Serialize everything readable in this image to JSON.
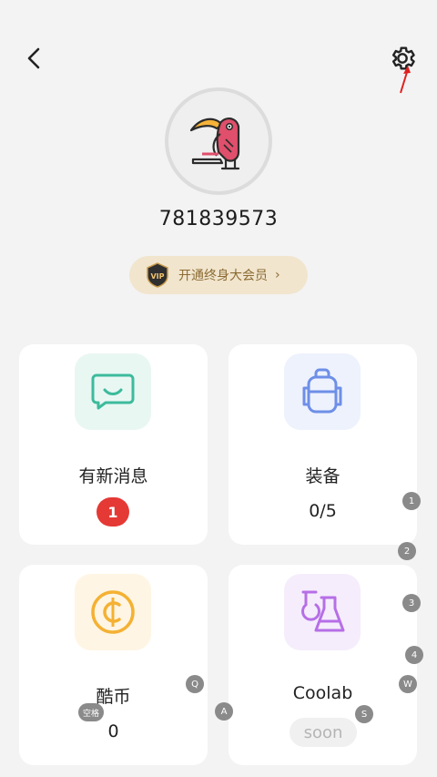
{
  "header": {
    "back_icon": "chevron-left-icon",
    "settings_icon": "gear-icon"
  },
  "profile": {
    "user_id": "781839573",
    "vip_badge_text": "VIP",
    "vip_label": "开通终身大会员",
    "vip_chevron": "›"
  },
  "cards": {
    "messages": {
      "title": "有新消息",
      "badge": "1",
      "icon": "chat-bubble-icon",
      "accent": "#3dbb9c"
    },
    "equipment": {
      "title": "装备",
      "value": "0/5",
      "icon": "backpack-icon",
      "accent": "#6e8fe8"
    },
    "coins": {
      "title": "酷币",
      "value": "0",
      "icon": "coin-icon",
      "accent": "#f4b133"
    },
    "coolab": {
      "title": "Coolab",
      "status": "soon",
      "icon": "flask-icon",
      "accent": "#b66fe6"
    }
  },
  "keyboard_hints": {
    "k1": "1",
    "k2": "2",
    "k3": "3",
    "k4": "4",
    "q": "Q",
    "w": "W",
    "a": "A",
    "s": "S",
    "space": "空格"
  }
}
